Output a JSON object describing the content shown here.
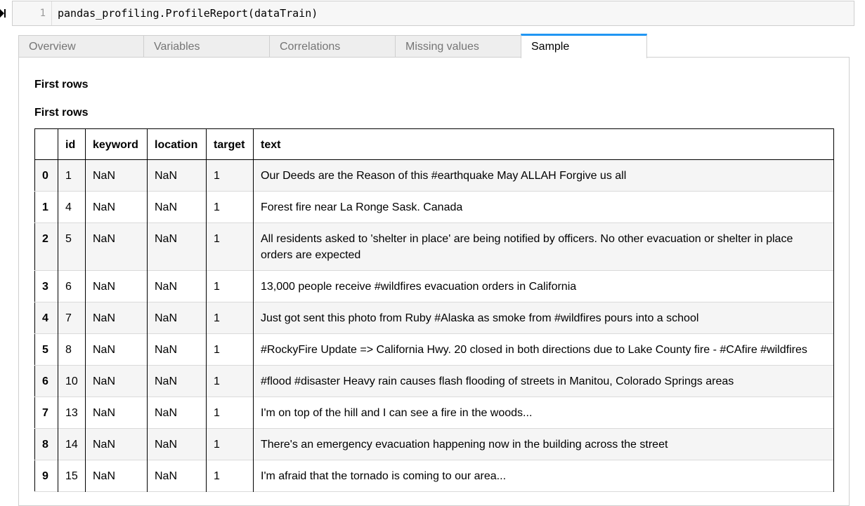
{
  "cell": {
    "line_number": "1",
    "code": "pandas_profiling.ProfileReport(dataTrain)"
  },
  "tabs": [
    {
      "label": "Overview",
      "active": false
    },
    {
      "label": "Variables",
      "active": false
    },
    {
      "label": "Correlations",
      "active": false
    },
    {
      "label": "Missing values",
      "active": false
    },
    {
      "label": "Sample",
      "active": true
    }
  ],
  "sample": {
    "heading_1": "First rows",
    "heading_2": "First rows",
    "columns": [
      "",
      "id",
      "keyword",
      "location",
      "target",
      "text"
    ],
    "rows": [
      {
        "index": "0",
        "id": "1",
        "keyword": "NaN",
        "location": "NaN",
        "target": "1",
        "text": "Our Deeds are the Reason of this #earthquake May ALLAH Forgive us all"
      },
      {
        "index": "1",
        "id": "4",
        "keyword": "NaN",
        "location": "NaN",
        "target": "1",
        "text": "Forest fire near La Ronge Sask. Canada"
      },
      {
        "index": "2",
        "id": "5",
        "keyword": "NaN",
        "location": "NaN",
        "target": "1",
        "text": "All residents asked to 'shelter in place' are being notified by officers. No other evacuation or shelter in place orders are expected"
      },
      {
        "index": "3",
        "id": "6",
        "keyword": "NaN",
        "location": "NaN",
        "target": "1",
        "text": "13,000 people receive #wildfires evacuation orders in California"
      },
      {
        "index": "4",
        "id": "7",
        "keyword": "NaN",
        "location": "NaN",
        "target": "1",
        "text": "Just got sent this photo from Ruby #Alaska as smoke from #wildfires pours into a school"
      },
      {
        "index": "5",
        "id": "8",
        "keyword": "NaN",
        "location": "NaN",
        "target": "1",
        "text": "#RockyFire Update => California Hwy. 20 closed in both directions due to Lake County fire - #CAfire #wildfires"
      },
      {
        "index": "6",
        "id": "10",
        "keyword": "NaN",
        "location": "NaN",
        "target": "1",
        "text": "#flood #disaster Heavy rain causes flash flooding of streets in Manitou, Colorado Springs areas"
      },
      {
        "index": "7",
        "id": "13",
        "keyword": "NaN",
        "location": "NaN",
        "target": "1",
        "text": "I'm on top of the hill and I can see a fire in the woods..."
      },
      {
        "index": "8",
        "id": "14",
        "keyword": "NaN",
        "location": "NaN",
        "target": "1",
        "text": "There's an emergency evacuation happening now in the building across the street"
      },
      {
        "index": "9",
        "id": "15",
        "keyword": "NaN",
        "location": "NaN",
        "target": "1",
        "text": "I'm afraid that the tornado is coming to our area..."
      }
    ]
  },
  "colors": {
    "active_tab_accent": "#2196f3",
    "tab_background": "#eeeeee",
    "row_stripe": "#f5f5f5"
  }
}
